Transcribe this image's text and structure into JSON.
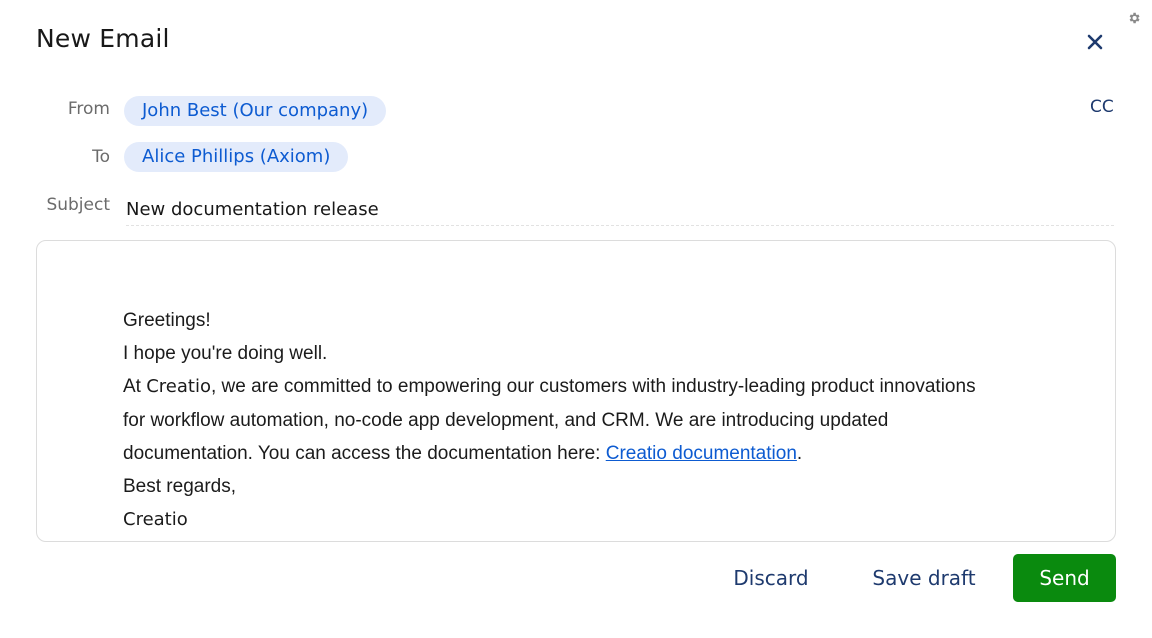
{
  "dialog": {
    "title": "New Email",
    "icons": {
      "close": "close-icon",
      "settings": "gear-icon"
    }
  },
  "from": {
    "label": "From",
    "value": "John Best (Our company)"
  },
  "to": {
    "label": "To",
    "value": "Alice Phillips (Axiom)"
  },
  "cc": {
    "label": "CC"
  },
  "subject": {
    "label": "Subject",
    "value": "New documentation release"
  },
  "body": {
    "line1": "Greetings!",
    "line2": "I hope you're doing well.",
    "line3_prefix": "At ",
    "line3_brand": "Creatio",
    "line3_rest": ", we are committed to empowering our customers with industry-leading product innovations",
    "line4": "for workflow automation, no-code app development, and CRM. We are introducing updated",
    "line5_prefix": "documentation. You can access the documentation  here: ",
    "line5_link": "Creatio documentation",
    "line5_suffix": ".",
    "line6": "Best regards,",
    "line7": "Creatio"
  },
  "actions": {
    "discard": "Discard",
    "save_draft": "Save draft",
    "send": "Send"
  },
  "colors": {
    "accent_blue": "#0d5bd1",
    "chip_bg": "#e3ebfb",
    "send_green": "#0a8a0e",
    "navy": "#1e3a6e"
  }
}
